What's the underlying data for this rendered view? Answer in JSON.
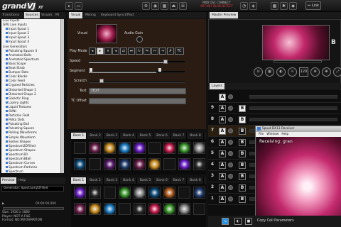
{
  "app": {
    "logo": "grand",
    "logo_v": "VJ",
    "logo_ver": "XT"
  },
  "status": {
    "l1": "MIDI  OSC  CONNECT",
    "l2": "ART-NET  BLOB-DETECT",
    "l3": ""
  },
  "link_label": "Link",
  "left_tabs": [
    "Transitions",
    "Sources",
    "Visuals",
    "Mi"
  ],
  "sources": [
    {
      "label": "Live Inputs",
      "child": false
    },
    {
      "label": "GPU Live Inputs",
      "child": false
    },
    {
      "label": "Input Spout 1",
      "child": true
    },
    {
      "label": "Input Spout 2",
      "child": true
    },
    {
      "label": "Input Spout 3",
      "child": true
    },
    {
      "label": "Input Spout 4",
      "child": true
    },
    {
      "label": "Live Generators",
      "child": false
    },
    {
      "label": "Pulsating Square 3",
      "child": true
    },
    {
      "label": "Animated Balls",
      "child": true
    },
    {
      "label": "Animated Spectrum",
      "child": true
    },
    {
      "label": "Bass Scope",
      "child": true
    },
    {
      "label": "Beat Strob",
      "child": true
    },
    {
      "label": "Bumper Dots",
      "child": true
    },
    {
      "label": "Color Blocks",
      "child": true
    },
    {
      "label": "Color Feed",
      "child": true
    },
    {
      "label": "Crypted Particles",
      "child": true
    },
    {
      "label": "Distorted Shape 1",
      "child": true
    },
    {
      "label": "Distorted Shape 2",
      "child": true
    },
    {
      "label": "Galactic Ring",
      "child": true
    },
    {
      "label": "Lazery Lights",
      "child": true
    },
    {
      "label": "Liquid Textures",
      "child": true
    },
    {
      "label": "OVNI",
      "child": true
    },
    {
      "label": "Particles Field",
      "child": true
    },
    {
      "label": "Polka Dots",
      "child": true
    },
    {
      "label": "Pulsating Ball",
      "child": true
    },
    {
      "label": "Pulsating Square",
      "child": true
    },
    {
      "label": "Rolling Waveforms",
      "child": true
    },
    {
      "label": "Simple Waveform",
      "child": true
    },
    {
      "label": "Sixties Shapes",
      "child": true
    },
    {
      "label": "Spectrum2DFilled",
      "child": true
    },
    {
      "label": "Spectrum Shapes",
      "child": true
    },
    {
      "label": "Spectrum3D",
      "child": true
    },
    {
      "label": "Spectrum3Ball",
      "child": true
    },
    {
      "label": "Spectrum Curves",
      "child": true
    },
    {
      "label": "Spectrum Particles",
      "child": true
    },
    {
      "label": "Spectrum",
      "child": true
    }
  ],
  "preview_tabs": [
    "Preview",
    "Help"
  ],
  "preview": {
    "generator": "Generator: Spectrum2DFilled",
    "time": "00:00:00.000",
    "size": "Size: 1920 x 1080",
    "player": "Player: NOT A FILE",
    "format": "Format: NO INFORMATION"
  },
  "visual_tabs": [
    "Visual",
    "Mixing",
    "Keyboard Sync",
    "Effect"
  ],
  "visual": {
    "visual_label": "Visual",
    "audio_gain_label": "Audio Gain",
    "play_mode_label": "Play Mode",
    "speed_label": "Speed",
    "segment_label": "Segment",
    "scratch_label": "Scratch",
    "text_label": "Text",
    "text_value": "TEXT",
    "tc_offset_label": "TC Offset",
    "tc_button": "TC",
    "speed_level": 0.8,
    "segment_level": 0.7
  },
  "bank_tabs_top": [
    "Bank 1",
    "Bank 2",
    "Bank 3",
    "Bank 4",
    "Bank 5",
    "Bank 6",
    "Bank 7",
    "Bank 8"
  ],
  "bank_tabs_bottom": [
    "Bank 1",
    "Bank 2",
    "Bank 3",
    "Bank 4",
    "Bank 5",
    "Bank 6",
    "Bank 7",
    "Bank 8"
  ],
  "master_preview_title": "Master Preview",
  "master": {
    "a": "A",
    "b": "B"
  },
  "master_ctrl": [
    "",
    "",
    "",
    "",
    "120",
    "",
    "",
    ""
  ],
  "layers_title": "Layers",
  "layers": [
    {
      "num": "",
      "a": "A",
      "b": ""
    },
    {
      "num": "9",
      "a": "A",
      "b": "B"
    },
    {
      "num": "8",
      "a": "A",
      "b": "B"
    },
    {
      "num": "7",
      "a": "A",
      "b": "B"
    },
    {
      "num": "6",
      "a": "A",
      "b": "B"
    },
    {
      "num": "5",
      "a": "A",
      "b": "B"
    },
    {
      "num": "4",
      "a": "A",
      "b": "B"
    },
    {
      "num": "3",
      "a": "A",
      "b": "B"
    },
    {
      "num": "2",
      "a": "A",
      "b": "B"
    },
    {
      "num": "1",
      "a": "A",
      "b": "B"
    }
  ],
  "spout": {
    "title": "Spout DX11 Receiver",
    "menu": [
      "File",
      "Window",
      "Help"
    ],
    "receiving": "Receiving: gran"
  },
  "bottom": {
    "copy": "Copy Cell Parameters"
  }
}
